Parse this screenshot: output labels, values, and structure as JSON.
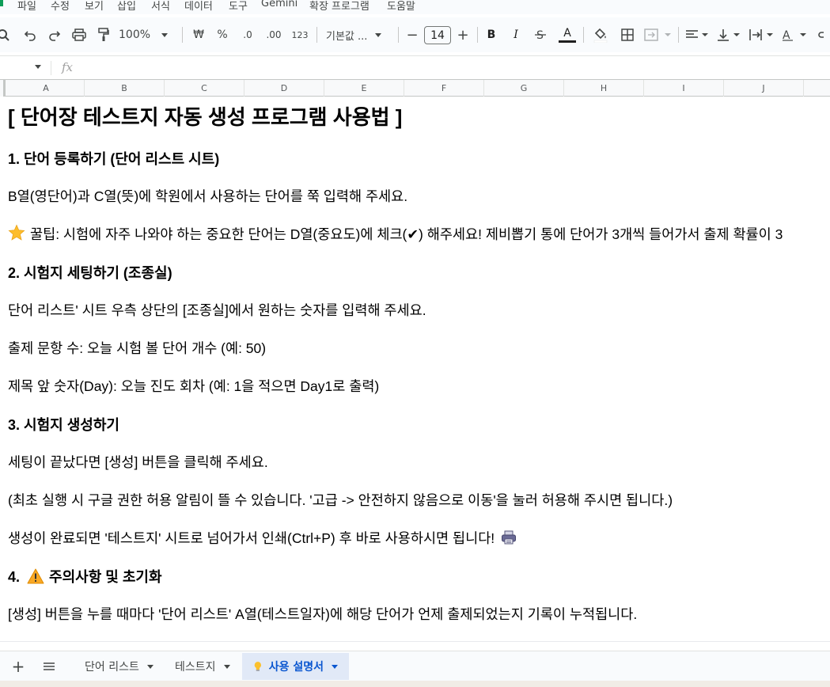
{
  "menu": {
    "items": [
      "파일",
      "수정",
      "보기",
      "삽입",
      "서식",
      "데이터",
      "도구",
      "Gemini",
      "확장 프로그램",
      "도움말"
    ]
  },
  "toolbar": {
    "zoom": "100%",
    "currency": "₩",
    "percent": "%",
    "decimal_decrease": ".0",
    "decimal_increase": ".00",
    "number_format": "123",
    "font_name": "기본값 ...",
    "font_size": "14",
    "bold": "B",
    "italic": "I",
    "text_color_letter": "A",
    "accent_text_color": "#1f1f1f"
  },
  "formula_bar": {
    "fx": "fx"
  },
  "columns": [
    "A",
    "B",
    "C",
    "D",
    "E",
    "F",
    "G",
    "H",
    "I",
    "J"
  ],
  "doc": {
    "title": "[ 단어장 테스트지 자동 생성 프로그램 사용법 ]",
    "s1_heading": "1. 단어 등록하기 (단어 리스트 시트)",
    "s1_p1": "B열(영단어)과 C열(뜻)에 학원에서 사용하는 단어를 쭉 입력해 주세요.",
    "s1_tip": "꿀팁: 시험에 자주 나와야 하는 중요한 단어는 D열(중요도)에 체크(✔) 해주세요! 제비뽑기 통에 단어가 3개씩 들어가서 출제 확률이 3",
    "s2_heading": "2. 시험지 세팅하기 (조종실)",
    "s2_p1": "단어 리스트' 시트 우측 상단의 [조종실]에서 원하는 숫자를 입력해 주세요.",
    "s2_p2": "출제 문항 수: 오늘 시험 볼 단어 개수 (예: 50)",
    "s2_p3": "제목 앞 숫자(Day): 오늘 진도 회차 (예: 1을 적으면 Day1로 출력)",
    "s3_heading": "3. 시험지 생성하기",
    "s3_p1": "세팅이 끝났다면 [생성] 버튼을 클릭해 주세요.",
    "s3_p2": "(최초 실행 시 구글 권한 허용 알림이 뜰 수 있습니다. '고급 -> 안전하지 않음으로 이동'을 눌러 허용해 주시면 됩니다.)",
    "s3_p3": "생성이 완료되면 '테스트지' 시트로 넘어가서 인쇄(Ctrl+P) 후 바로 사용하시면 됩니다!",
    "s4_heading_num": "4.",
    "s4_heading": "주의사항 및 초기화",
    "s4_p1": "[생성] 버튼을 누를 때마다 '단어 리스트' A열(테스트일자)에 해당 단어가 언제 출제되었는지 기록이 누적됩니다."
  },
  "tabs": {
    "add": "+",
    "all_sheets": "≡",
    "sheets": [
      {
        "label": "단어 리스트",
        "active": false
      },
      {
        "label": "테스트지",
        "active": false
      },
      {
        "label": "사용 설명서",
        "active": true
      }
    ]
  },
  "colors": {
    "active_tab_bg": "#e1e9f7",
    "active_tab_text": "#0b57d0",
    "sheets_green": "#0f9d58"
  }
}
